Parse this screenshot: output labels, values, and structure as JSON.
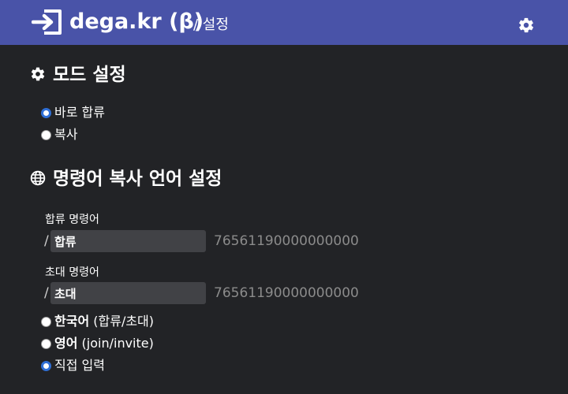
{
  "header": {
    "title": "dega.kr (β)",
    "subtitle": "/ 설정",
    "colors": {
      "bar": "#4953a8",
      "background": "#222326"
    },
    "brand_icon": "login-icon",
    "settings_icon": "gear-icon"
  },
  "mode_section": {
    "title": "모드 설정",
    "icon": "gear-icon",
    "options": [
      {
        "label": "바로 합류",
        "checked": true
      },
      {
        "label": "복사",
        "checked": false
      }
    ]
  },
  "language_section": {
    "title": "명령어 복사 언어 설정",
    "icon": "globe-icon",
    "join_field": {
      "label": "합류 명령어",
      "prefix": "/",
      "value": "합류",
      "hint": "76561190000000000"
    },
    "invite_field": {
      "label": "초대 명령어",
      "prefix": "/",
      "value": "초대",
      "hint": "76561190000000000"
    },
    "options": [
      {
        "bold": "한국어",
        "rest": " (합류/초대)",
        "checked": false
      },
      {
        "bold": "영어",
        "rest": " (join/invite)",
        "checked": false
      },
      {
        "bold": "",
        "rest": "직접 입력",
        "checked": true
      }
    ]
  }
}
